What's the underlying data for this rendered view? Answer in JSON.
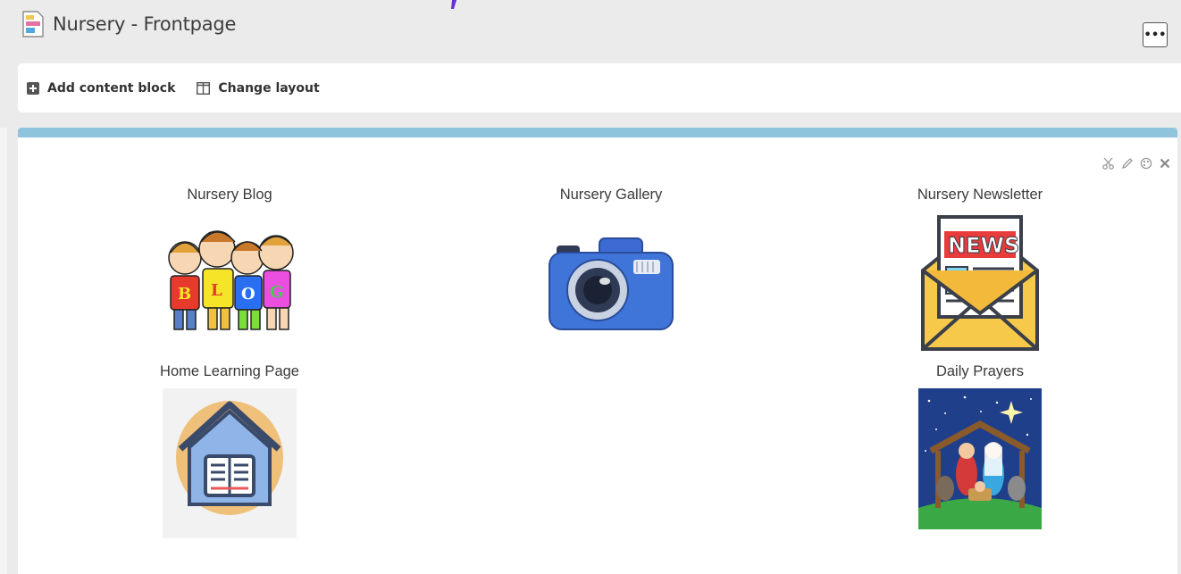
{
  "header": {
    "title": "Nursery - Frontpage",
    "more_label": "•••",
    "page_icon": "page-layout-icon"
  },
  "toolbar": {
    "add_label": "Add content block",
    "layout_label": "Change layout"
  },
  "block_tools": [
    "cut-icon",
    "pencil-icon",
    "color-palette-icon",
    "close-icon"
  ],
  "tiles": [
    {
      "title": "Nursery Blog",
      "image": "blog-children-illustration"
    },
    {
      "title": "Nursery Gallery",
      "image": "camera-illustration"
    },
    {
      "title": "Nursery Newsletter",
      "image": "newsletter-envelope-illustration"
    },
    {
      "title": "Home Learning Page",
      "image": "house-with-book-illustration"
    },
    {
      "title": "Daily Prayers",
      "image": "nativity-scene-illustration"
    }
  ],
  "colors": {
    "panel_accent": "#8ec5dd",
    "header_bg": "#ebebeb"
  }
}
